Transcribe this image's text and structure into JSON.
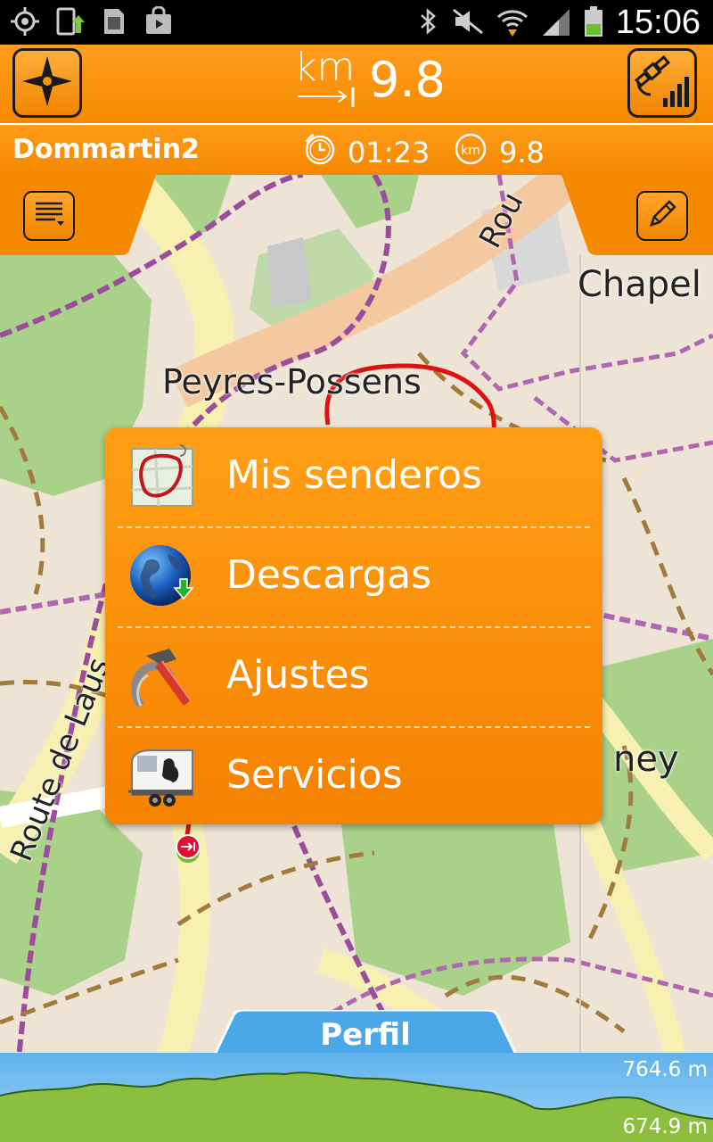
{
  "status_bar": {
    "time": "15:06",
    "left_icons": [
      "gps-icon",
      "phone-upload-icon",
      "sd-card-icon",
      "shop-bag-icon"
    ],
    "right_icons": [
      "bluetooth-icon",
      "mute-icon",
      "wifi-icon",
      "signal-icon",
      "battery-icon"
    ]
  },
  "header": {
    "distance_unit": "km",
    "distance_value": "9.8",
    "left_button_icon": "compass-icon",
    "right_button_icon": "satellite-signal-icon"
  },
  "info_bar": {
    "route_name": "Dommartin2",
    "duration": "01:23",
    "distance": "9.8"
  },
  "map_labels": {
    "chapel": "Chapel",
    "peyres": "Peyres-Possens",
    "route_lausanne": "Route de Laus",
    "rou": "Rou",
    "ney": "ney"
  },
  "menu": {
    "items": [
      {
        "label": "Mis senderos",
        "icon": "trail-map-icon"
      },
      {
        "label": "Descargas",
        "icon": "globe-download-icon"
      },
      {
        "label": "Ajustes",
        "icon": "hammer-horseshoe-icon"
      },
      {
        "label": "Servicios",
        "icon": "horse-trailer-icon"
      }
    ]
  },
  "profile": {
    "tab_label": "Perfil",
    "max_altitude": "764.6 m",
    "min_altitude": "674.9 m"
  },
  "colors": {
    "accent": "#f58a00",
    "profile_sky": "#6fbcef",
    "profile_ground": "#8cbf3f",
    "track": "#e01010"
  }
}
